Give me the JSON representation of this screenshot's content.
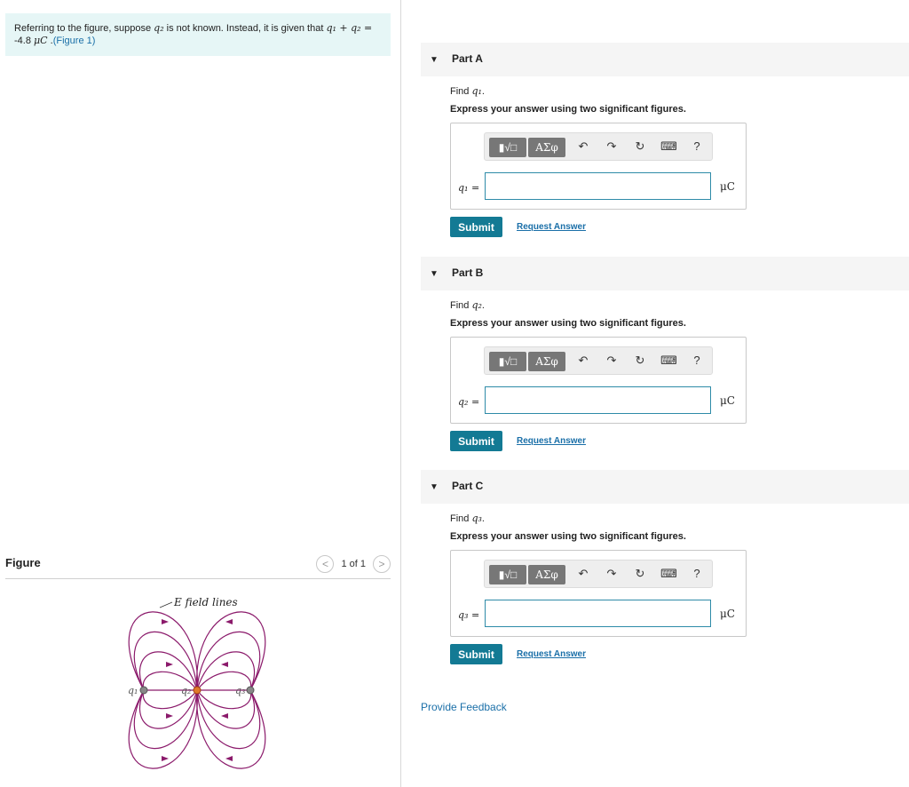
{
  "intro": {
    "text_start": "Referring to the figure, suppose ",
    "var_q2": "q₂",
    "text_mid": " is not known. Instead, it is given that ",
    "equation": "q₁ + q₂ =",
    "value": "-4.8 ",
    "unit": "μC",
    "text_end": " .",
    "figure_link": "(Figure 1)"
  },
  "figure": {
    "title": "Figure",
    "pager_prev": "<",
    "pager_count": "1 of 1",
    "pager_next": ">",
    "field_label": "E field lines",
    "charge_labels": [
      "q₁",
      "q₂",
      "q₃"
    ]
  },
  "parts": [
    {
      "label": "Part A",
      "find_prefix": "Find ",
      "find_var": "q₁",
      "find_suffix": ".",
      "instruction": "Express your answer using two significant figures.",
      "var_label": "q₁ =",
      "unit": "μC",
      "submit": "Submit",
      "request": "Request Answer"
    },
    {
      "label": "Part B",
      "find_prefix": "Find ",
      "find_var": "q₂",
      "find_suffix": ".",
      "instruction": "Express your answer using two significant figures.",
      "var_label": "q₂ =",
      "unit": "μC",
      "submit": "Submit",
      "request": "Request Answer"
    },
    {
      "label": "Part C",
      "find_prefix": "Find ",
      "find_var": "q₃",
      "find_suffix": ".",
      "instruction": "Express your answer using two significant figures.",
      "var_label": "q₃ =",
      "unit": "μC",
      "submit": "Submit",
      "request": "Request Answer"
    }
  ],
  "toolbar": {
    "templates_label": "▮√□",
    "symbols_label": "ΑΣφ",
    "undo": "↶",
    "redo": "↷",
    "reset": "↻",
    "keyboard": "⌨",
    "help": "?"
  },
  "feedback_label": "Provide Feedback",
  "colors": {
    "intro_bg": "#e6f6f6",
    "submit_bg": "#137a94",
    "link": "#1a6fa8",
    "field_lines": "#8b1a6b"
  }
}
